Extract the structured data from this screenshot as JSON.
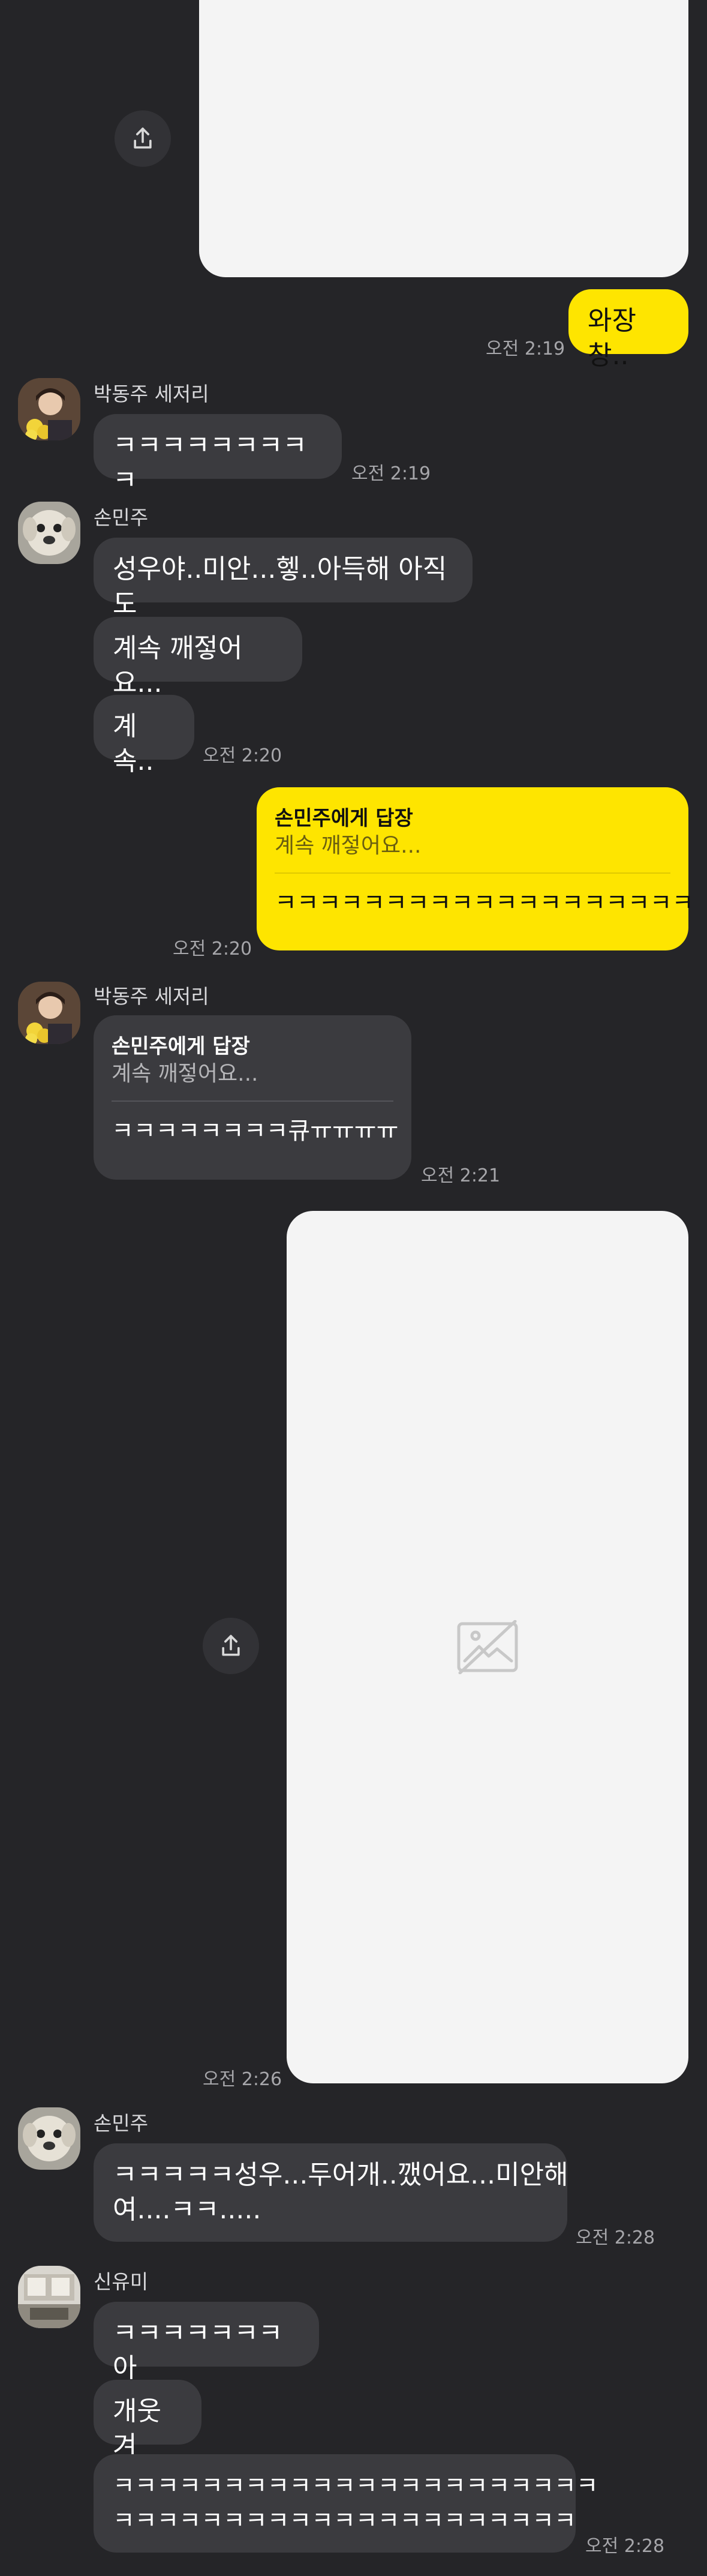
{
  "colors": {
    "background": "#252528",
    "bubble_gray": "#3b3b3f",
    "bubble_yellow": "#fee500",
    "image_card": "#f4f4f4"
  },
  "icons": {
    "share": "share-icon",
    "image_broken": "broken-image-icon"
  },
  "messages": {
    "m1": {
      "text": "와장창..",
      "time": "오전 2:19"
    },
    "m2": {
      "sender": "박동주 세저리",
      "text": "ㅋㅋㅋㅋㅋㅋㅋㅋㅋ",
      "time": "오전 2:19"
    },
    "m3": {
      "sender": "손민주",
      "text1": "성우야..미안...헿..아득해 아직도",
      "text2": "계속 깨젛어요...",
      "text3": "계속..",
      "time": "오전 2:20"
    },
    "m4": {
      "reply_title": "손민주에게 답장",
      "reply_quote": "계속 깨젛어요...",
      "text": "ㅋㅋㅋㅋㅋㅋㅋㅋㅋㅋㅋㅋㅋㅋㅋㅋㅋㅋㅋ",
      "time": "오전 2:20"
    },
    "m5": {
      "sender": "박동주 세저리",
      "reply_title": "손민주에게 답장",
      "reply_quote": "계속 깨젛어요...",
      "text": "ㅋㅋㅋㅋㅋㅋㅋㅋ큐ㅠㅠㅠㅠ",
      "time": "오전 2:21"
    },
    "m6": {
      "time": "오전 2:26"
    },
    "m7": {
      "sender": "손민주",
      "line1": "ㅋㅋㅋㅋㅋ성우...두어개..깼어요...미안해",
      "line2": "여....ㅋㅋ.....",
      "time": "오전 2:28"
    },
    "m8": {
      "sender": "신유미",
      "text1": "ㅋㅋㅋㅋㅋㅋㅋ아",
      "text2": "개웃겨",
      "line1": "ㅋㅋㅋㅋㅋㅋㅋㅋㅋㅋㅋㅋㅋㅋㅋㅋㅋㅋㅋㅋㅋㅋ",
      "line2": "ㅋㅋㅋㅋㅋㅋㅋㅋㅋㅋㅋㅋㅋㅋㅋㅋㅋㅋㅋㅋㅋ",
      "time": "오전 2:28"
    }
  }
}
